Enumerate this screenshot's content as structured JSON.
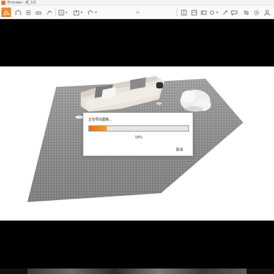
{
  "window": {
    "title": "Enscape - 桌_1/2"
  },
  "toolbar": {
    "left_icons": [
      "render-icon",
      "video-icon",
      "panorama-icon",
      "batch-icon",
      "walk-icon",
      "vr-icon",
      "screenshot-icon",
      "export-icon",
      "upload-icon"
    ],
    "right_icons": [
      "asset-library-icon",
      "material-icon",
      "views-icon",
      "sun-icon",
      "settings-icon",
      "help-icon",
      "feedback-icon",
      "visual-settings-icon",
      "general-settings-icon",
      "account-icon"
    ]
  },
  "dialog": {
    "message": "正在导出图像...",
    "progress_text": "18%",
    "progress_value": 0.18,
    "cancel_label": "取消"
  },
  "colors": {
    "accent": "#f08a2c",
    "progress_start": "#f26a10",
    "progress_end": "#f7a21a"
  }
}
